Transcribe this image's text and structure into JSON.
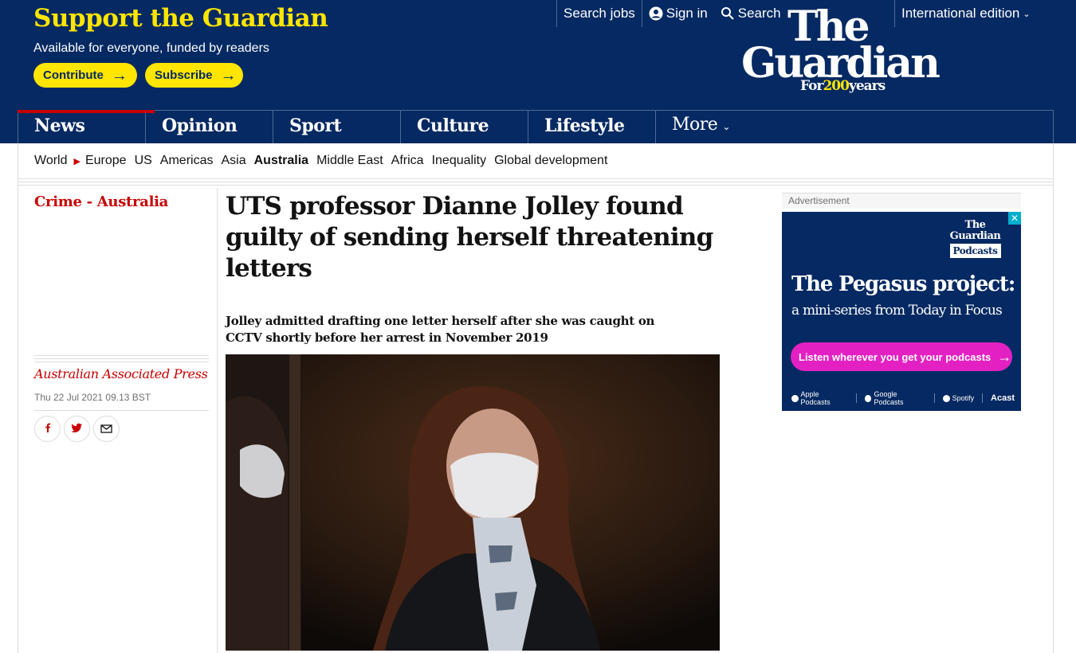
{
  "support": {
    "title": "Support the Guardian",
    "subtitle": "Available for everyone, funded by readers",
    "contribute_label": "Contribute",
    "subscribe_label": "Subscribe"
  },
  "top_links": {
    "search_jobs": "Search jobs",
    "sign_in": "Sign in",
    "search": "Search",
    "edition": "International edition"
  },
  "logo": {
    "line1": "The",
    "line2": "Guardian",
    "tag_prefix": "For",
    "tag_number": "200",
    "tag_suffix": "years"
  },
  "pillars": [
    "News",
    "Opinion",
    "Sport",
    "Culture",
    "Lifestyle"
  ],
  "more_label": "More",
  "subnav": {
    "items": [
      "World",
      "Europe",
      "US",
      "Americas",
      "Asia",
      "Australia",
      "Middle East",
      "Africa",
      "Inequality",
      "Global development"
    ],
    "active": "Australia"
  },
  "article": {
    "kicker": "Crime - Australia",
    "headline": "UTS professor Dianne Jolley found guilty of sending herself threatening letters",
    "standfirst": "Jolley admitted drafting one letter herself after she was caught on CCTV shortly before her arrest in November 2019",
    "byline": "Australian Associated Press",
    "date": "Thu 22 Jul 2021 09.13 BST"
  },
  "share": [
    "facebook-icon",
    "twitter-icon",
    "email-icon"
  ],
  "ad": {
    "label": "Advertisement",
    "logo_top": "The Guardian",
    "logo_badge": "Podcasts",
    "title": "The Pegasus project:",
    "subtitle": "a mini-series from Today in Focus",
    "cta": "Listen wherever you get your podcasts",
    "platforms": [
      "Apple Podcasts",
      "Google Podcasts",
      "Spotify",
      "Acast"
    ]
  },
  "colors": {
    "brand": "#052962",
    "yellow": "#ffe500",
    "news_red": "#c70000",
    "ad_pink": "#e321c3"
  }
}
